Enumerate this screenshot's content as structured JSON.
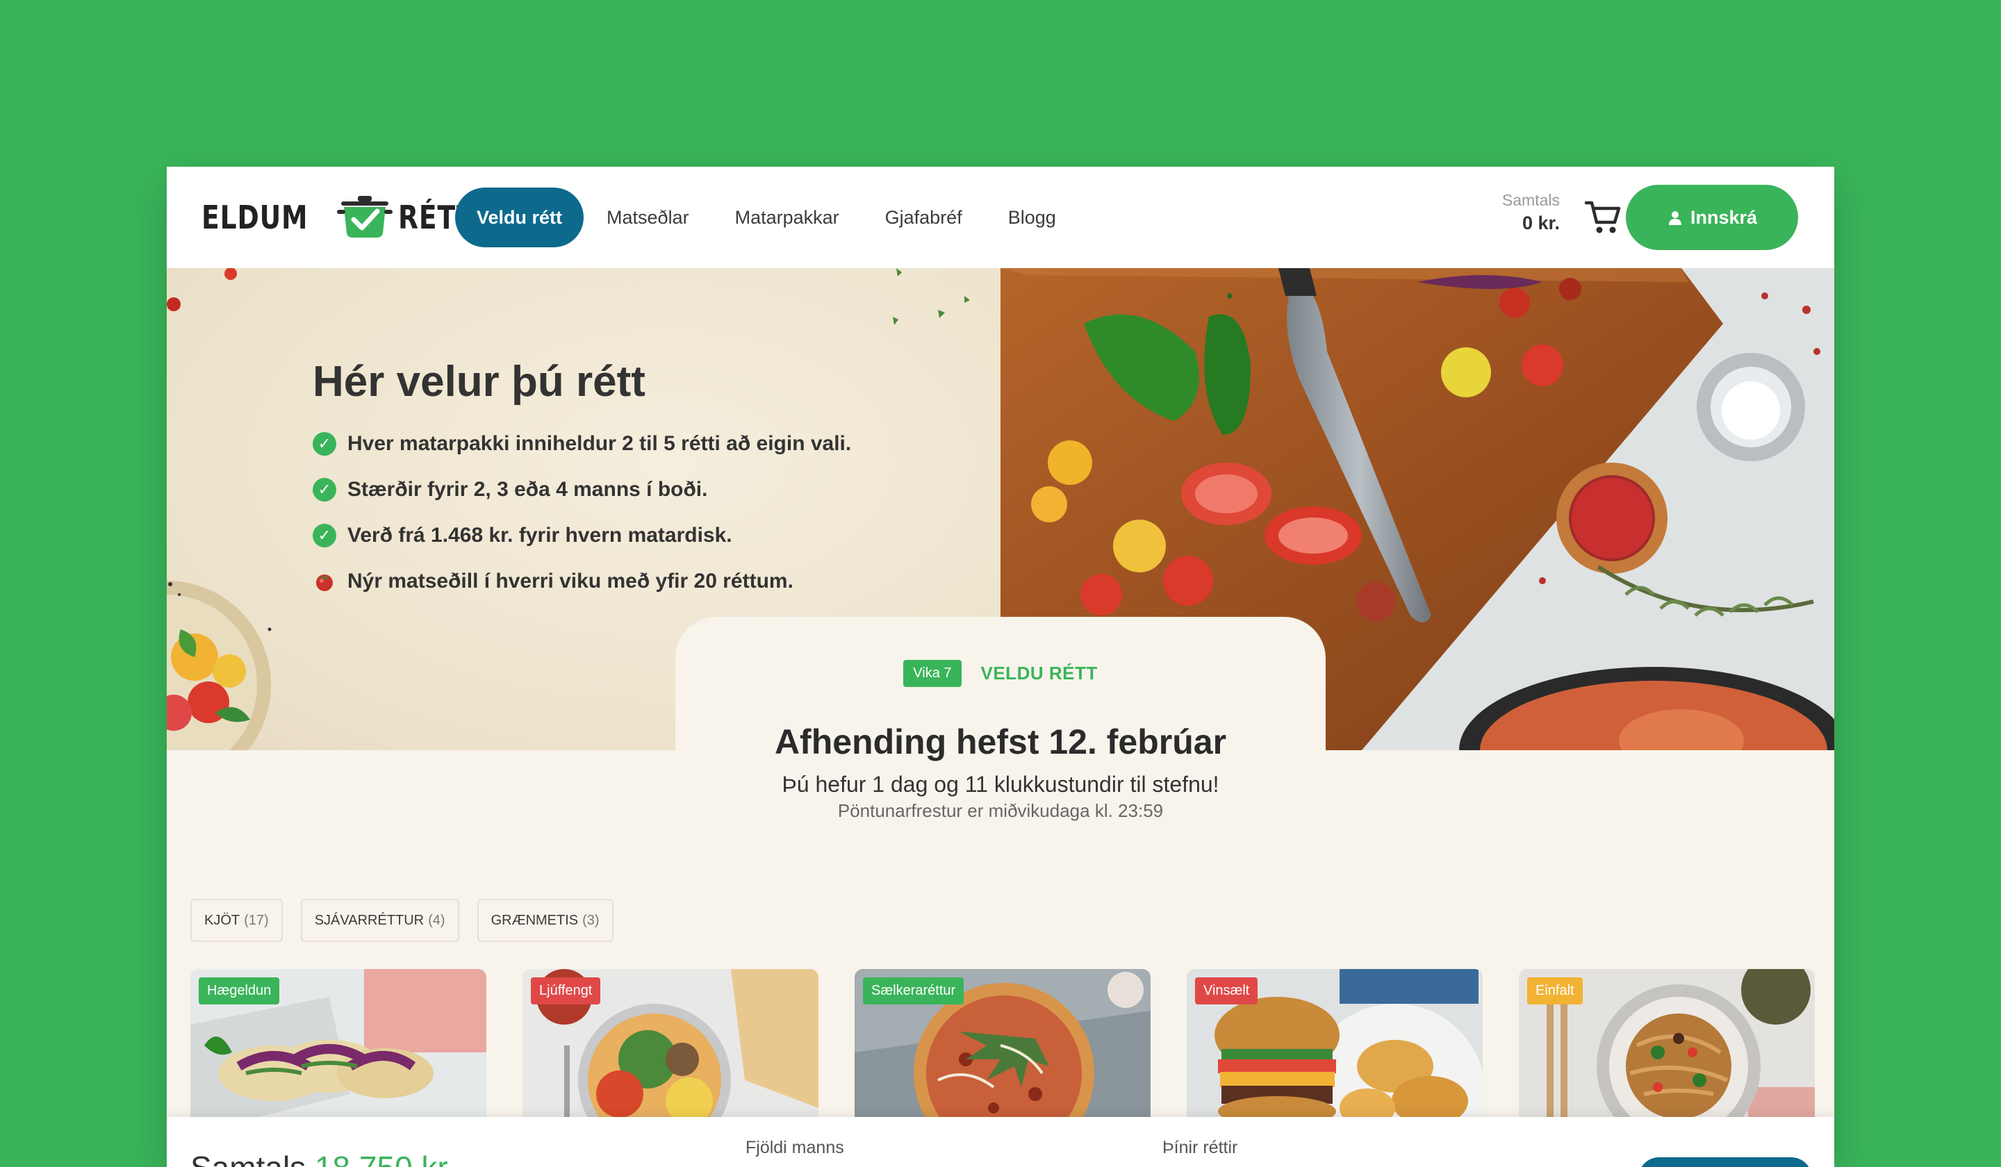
{
  "brand": {
    "word1": "ELDUM",
    "word2": "RÉTT"
  },
  "nav": {
    "items": [
      {
        "label": "Veldu rétt",
        "active": true
      },
      {
        "label": "Matseðlar"
      },
      {
        "label": "Matarpakkar"
      },
      {
        "label": "Gjafabréf"
      },
      {
        "label": "Blogg"
      }
    ]
  },
  "cart": {
    "label": "Samtals",
    "value": "0 kr."
  },
  "login": {
    "label": "Innskrá"
  },
  "hero": {
    "title": "Hér velur þú rétt",
    "features": [
      "Hver matarpakki inniheldur 2 til 5 rétti að eigin vali.",
      "Stærðir fyrir 2, 3 eða 4 manns í boði.",
      "Verð frá 1.468 kr. fyrir hvern matardisk.",
      "Nýr matseðill í hverri viku með yfir 20 réttum."
    ]
  },
  "delivery": {
    "week": "Vika 7",
    "label": "VELDU RÉTT",
    "title": "Afhending hefst 12. febrúar",
    "countdown": "Þú hefur 1 dag og 11 klukkustundir til stefnu!",
    "deadline": "Pöntunarfrestur er miðvikudaga kl. 23:59"
  },
  "filters": [
    {
      "label": "KJÖT",
      "count": "(17)"
    },
    {
      "label": "SJÁVARRÉTTUR",
      "count": "(4)"
    },
    {
      "label": "GRÆNMETIS",
      "count": "(3)"
    }
  ],
  "cards": [
    {
      "tag": "Hægeldun",
      "tag_color": "#3ab45a"
    },
    {
      "tag": "Ljúffengt",
      "tag_color": "#e04848"
    },
    {
      "tag": "Sælkeraréttur",
      "tag_color": "#3ab45a"
    },
    {
      "tag": "Vinsælt",
      "tag_color": "#e04848"
    },
    {
      "tag": "Einfalt",
      "tag_color": "#f2b233"
    }
  ],
  "bottom": {
    "sum_label": "Samtals",
    "sum_value": "18.750 kr.",
    "people_label": "Fjöldi manns",
    "dishes_label": "Þínir réttir"
  },
  "colors": {
    "brand_green": "#3ab45a",
    "brand_blue": "#0d6a8c"
  }
}
